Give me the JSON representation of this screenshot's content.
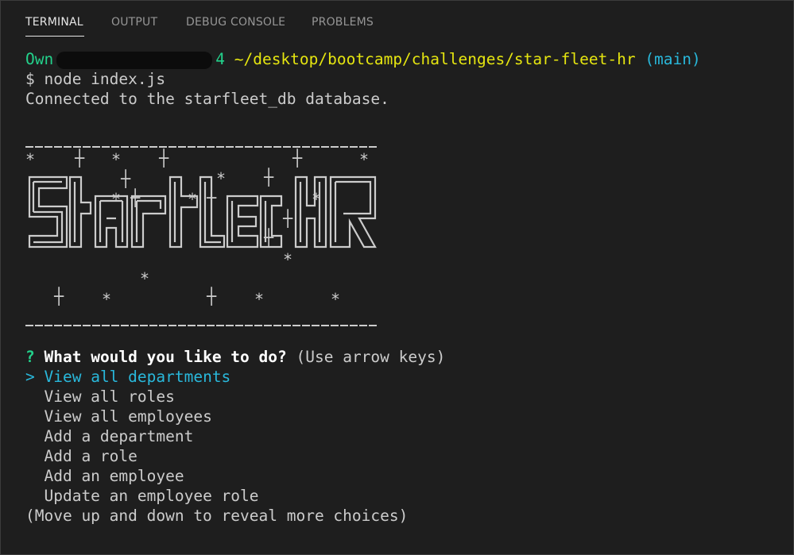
{
  "panel": {
    "tabs": [
      {
        "label": "TERMINAL",
        "active": true
      },
      {
        "label": "OUTPUT",
        "active": false
      },
      {
        "label": "DEBUG CONSOLE",
        "active": false
      },
      {
        "label": "PROBLEMS",
        "active": false
      }
    ]
  },
  "terminal": {
    "prompt_user": "Own",
    "prompt_host_fragment": "4",
    "prompt_path": "~/desktop/bootcamp/challenges/star-fleet-hr",
    "prompt_branch": "(main)",
    "command_line": "$ node index.js",
    "output_line": "Connected to the starfleet_db database.",
    "question_mark": "?",
    "question": "What would you like to do?",
    "question_hint": "(Use arrow keys)",
    "pointer": ">",
    "choices": [
      "View all departments",
      "View all roles",
      "View all employees",
      "Add a department",
      "Add a role",
      "Add an employee",
      "Update an employee role"
    ],
    "footer_hint": "(Move up and down to reveal more choices)"
  },
  "colors": {
    "background": "#1e1e1e",
    "green": "#23d18b",
    "yellow": "#e5e510",
    "cyan": "#29b8db",
    "text": "#cccccc"
  },
  "banner_text": "StarFleet HR"
}
